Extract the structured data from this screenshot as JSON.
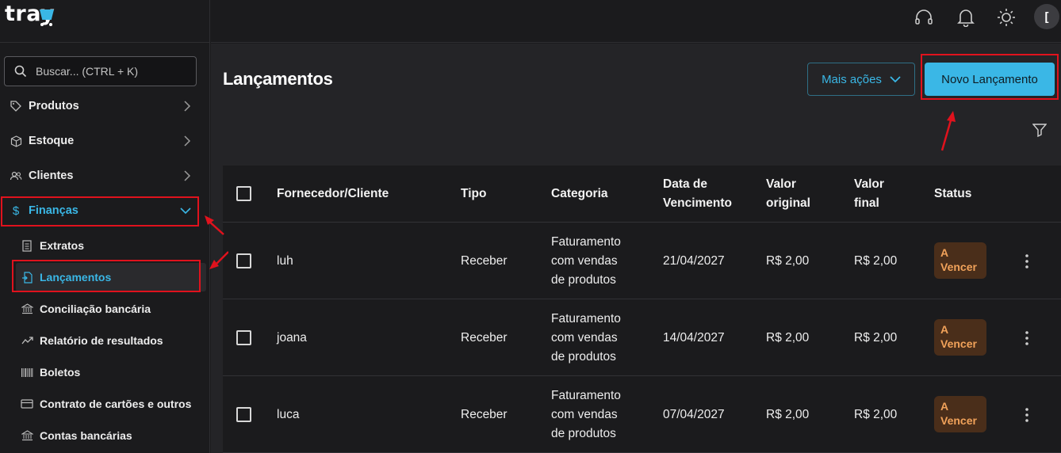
{
  "brand": {
    "logo_text": "tray"
  },
  "search": {
    "placeholder": "Buscar... (CTRL + K)"
  },
  "sidebar": {
    "items": [
      {
        "label": "Produtos",
        "icon": "tag-icon"
      },
      {
        "label": "Estoque",
        "icon": "box-icon"
      },
      {
        "label": "Clientes",
        "icon": "users-icon"
      },
      {
        "label": "Finanças",
        "icon": "dollar-icon",
        "expanded": true
      }
    ],
    "sub_items": [
      {
        "label": "Extratos",
        "icon": "document-icon"
      },
      {
        "label": "Lançamentos",
        "icon": "entry-icon",
        "active": true
      },
      {
        "label": "Conciliação bancária",
        "icon": "bank-icon"
      },
      {
        "label": "Relatório de resultados",
        "icon": "trend-icon"
      },
      {
        "label": "Boletos",
        "icon": "barcode-icon"
      },
      {
        "label": "Contrato de cartões e outros",
        "icon": "card-icon"
      },
      {
        "label": "Contas bancárias",
        "icon": "bank-icon"
      }
    ]
  },
  "topbar": {
    "icons": [
      "headset-icon",
      "bell-icon",
      "sun-icon"
    ],
    "avatar_initial": "["
  },
  "page": {
    "title": "Lançamentos",
    "more_actions_label": "Mais ações",
    "new_entry_label": "Novo Lançamento"
  },
  "table": {
    "headers": {
      "supplier": "Fornecedor/Cliente",
      "type": "Tipo",
      "category": "Categoria",
      "due_1": "Data de",
      "due_2": "Vencimento",
      "orig_1": "Valor",
      "orig_2": "original",
      "final_1": "Valor",
      "final_2": "final",
      "status": "Status"
    },
    "rows": [
      {
        "supplier": "luh",
        "type": "Receber",
        "cat_1": "Faturamento",
        "cat_2": "com vendas",
        "cat_3": "de produtos",
        "due": "21/04/2027",
        "original": "R$ 2,00",
        "final": "R$ 2,00",
        "status_1": "A",
        "status_2": "Vencer"
      },
      {
        "supplier": "joana",
        "type": "Receber",
        "cat_1": "Faturamento",
        "cat_2": "com vendas",
        "cat_3": "de produtos",
        "due": "14/04/2027",
        "original": "R$ 2,00",
        "final": "R$ 2,00",
        "status_1": "A",
        "status_2": "Vencer"
      },
      {
        "supplier": "luca",
        "type": "Receber",
        "cat_1": "Faturamento",
        "cat_2": "com vendas",
        "cat_3": "de produtos",
        "due": "07/04/2027",
        "original": "R$ 2,00",
        "final": "R$ 2,00",
        "status_1": "A",
        "status_2": "Vencer"
      }
    ]
  },
  "colors": {
    "accent": "#3ab7e6",
    "highlight": "#e0121d",
    "badge_bg": "#4a2e1a",
    "badge_text": "#f1a25a"
  }
}
